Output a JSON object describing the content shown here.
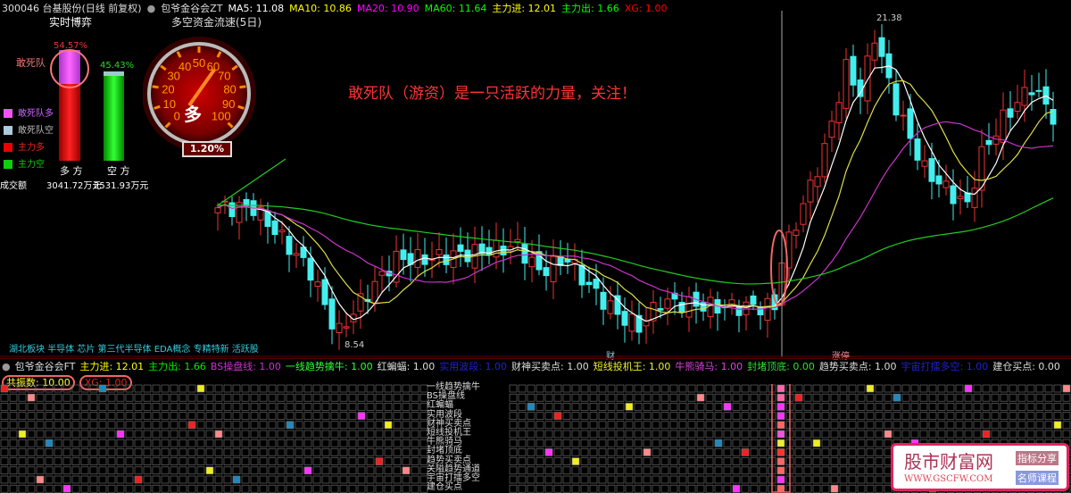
{
  "header": {
    "stock": "300046 台基股份(日线 前复权)",
    "indicator": "包爷金谷会ZT",
    "ma5": "MA5: 11.08",
    "ma10": "MA10: 10.86",
    "ma20": "MA20: 10.90",
    "ma60": "MA60: 11.64",
    "zljin": "主力进: 12.01",
    "zlchu": "主力出: 1.66",
    "xg": "XG: 1.00"
  },
  "realtime": {
    "title": "实时博弈",
    "pct_bull": "54.57%",
    "pct_bear": "45.43%",
    "dare_label": "敢死队",
    "legend": [
      "敢死队多",
      "敢死队空",
      "主力多",
      "主力空"
    ],
    "bull": "多 方",
    "bear": "空 方",
    "volume_label": "成交额",
    "bull_amount": "3041.72万元",
    "bear_amount": "2531.93万元",
    "bull_fraction": 0.5457
  },
  "gauge": {
    "title": "多空资金流速(5日)",
    "ticks": [
      "0",
      "10",
      "20",
      "30",
      "40",
      "50",
      "60",
      "70",
      "80",
      "90",
      "100"
    ],
    "center_label": "多",
    "value": "1.20%",
    "needle_value": 62
  },
  "annotation": "敢死队（游资）是一只活跃的力量，关注！",
  "price_labels": {
    "high": "21.38",
    "low": "8.54"
  },
  "concepts": "湖北板块 半导体 芯片 第三代半导体 EDA概念 专精特新 活跃股",
  "markers": {
    "m1": "财",
    "m2": "涨停"
  },
  "chart_data": {
    "type": "candlestick",
    "keypoints": [
      [
        0,
        13.9
      ],
      [
        5,
        13.9
      ],
      [
        8,
        13.0
      ],
      [
        13,
        11.4
      ],
      [
        16,
        9.4
      ],
      [
        17,
        9.0
      ],
      [
        20,
        10.2
      ],
      [
        25,
        11.9
      ],
      [
        29,
        11.9
      ],
      [
        35,
        12.1
      ],
      [
        42,
        12.4
      ],
      [
        45,
        11.4
      ],
      [
        49,
        11.9
      ],
      [
        52,
        10.8
      ],
      [
        56,
        9.7
      ],
      [
        59,
        9.2
      ],
      [
        62,
        10.2
      ],
      [
        70,
        10.0
      ],
      [
        78,
        10.0
      ],
      [
        79,
        11.9
      ],
      [
        81,
        13.3
      ],
      [
        85,
        16.2
      ],
      [
        88,
        19.4
      ],
      [
        90,
        18.4
      ],
      [
        92,
        20.7
      ],
      [
        95,
        17.9
      ],
      [
        99,
        15.4
      ],
      [
        103,
        14.4
      ],
      [
        105,
        14.0
      ],
      [
        107,
        16.0
      ],
      [
        110,
        17.4
      ],
      [
        114,
        18.7
      ],
      [
        117,
        17.5
      ]
    ],
    "high": 21.38,
    "low": 8.54
  },
  "sub": {
    "title": "包爷金谷会FT",
    "zljin": "主力进: 12.01",
    "zlchu": "主力出: 1.66",
    "bs": "BS操盘线: 1.00",
    "yxqs": "一线趋势擒牛: 1.00",
    "hbf": "红蝙蝠: 1.00",
    "syb": "实用波段: 1.00",
    "cs": "财神买卖点: 1.00",
    "dx": "短线投机王: 1.00",
    "nx": "牛熊骑马: 1.00",
    "fd": "封堵顶底: 0.00",
    "qs": "趋势买卖点: 1.00",
    "yz": "宇宙打擂多空: 1.00",
    "jc": "建仓买点: 0.00",
    "gzs": "共振数: 10.00",
    "xg": "XG: 1.00"
  },
  "grid_rows": [
    "一线趋势擒牛",
    "BS操盘线",
    "红蝙蝠",
    "实用波段",
    "财神买卖点",
    "短线投机王",
    "牛熊骑马",
    "封堵顶底",
    "趋势买卖点",
    "关隘趋势通道",
    "宇宙打擂多空",
    "建仓买点"
  ],
  "watermark": {
    "name": "股市财富网",
    "url": "WWW.GSCFW.COM",
    "tag1": "指标分享",
    "tag2": "名师课程"
  }
}
